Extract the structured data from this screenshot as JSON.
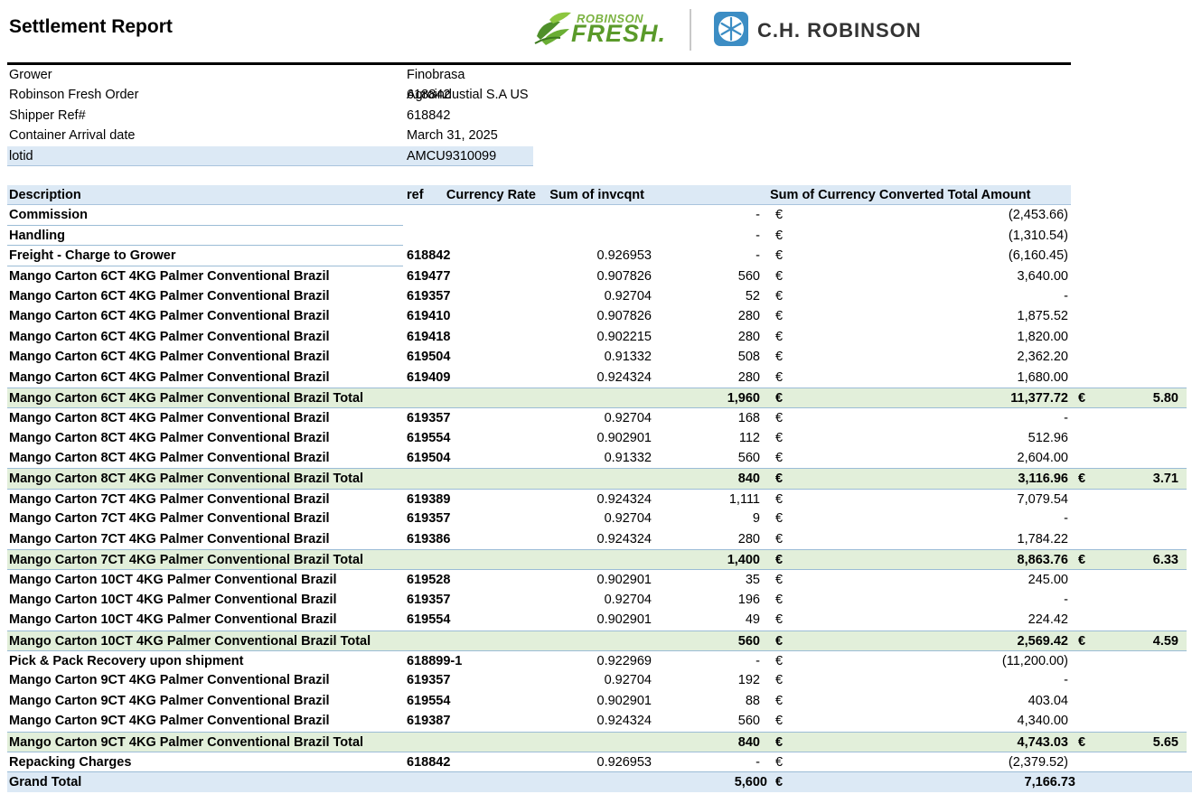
{
  "header": {
    "title": "Settlement Report",
    "logo_fresh_top": "ROBINSON",
    "logo_fresh_main": "FRESH.",
    "logo_chr": "C.H. ROBINSON"
  },
  "info": [
    {
      "label": "Grower",
      "value": "Finobrasa Agroindustial S.A US"
    },
    {
      "label": "Robinson Fresh Order",
      "value": "618842"
    },
    {
      "label": "Shipper Ref#",
      "value": "618842"
    },
    {
      "label": "Container Arrival date",
      "value": "March 31, 2025"
    },
    {
      "label": "lotid",
      "value": "AMCU9310099"
    }
  ],
  "table": {
    "columns": {
      "description": "Description",
      "ref": "ref",
      "rate": "Currency Rate",
      "qty": "Sum of invcqnt",
      "amount": "Sum of Currency Converted Total Amount"
    },
    "rows": [
      {
        "desc": "Commission",
        "ref": "",
        "rate": "",
        "qty": "-",
        "cur": "€",
        "amt": "(2,453.66)",
        "type": "plain"
      },
      {
        "desc": "Handling",
        "ref": "",
        "rate": "",
        "qty": "-",
        "cur": "€",
        "amt": "(1,310.54)",
        "type": "plain"
      },
      {
        "desc": "Freight - Charge to Grower",
        "ref": "618842",
        "rate": "0.926953",
        "qty": "-",
        "cur": "€",
        "amt": "(6,160.45)",
        "type": "plain"
      },
      {
        "desc": "Mango Carton 6CT 4KG Palmer Conventional Brazil",
        "ref": "619477",
        "rate": "0.907826",
        "qty": "560",
        "cur": "€",
        "amt": "3,640.00",
        "type": "plain"
      },
      {
        "desc": "Mango Carton 6CT 4KG Palmer Conventional Brazil",
        "ref": "619357",
        "rate": "0.92704",
        "qty": "52",
        "cur": "€",
        "amt": "-",
        "type": "plain"
      },
      {
        "desc": "Mango Carton 6CT 4KG Palmer Conventional Brazil",
        "ref": "619410",
        "rate": "0.907826",
        "qty": "280",
        "cur": "€",
        "amt": "1,875.52",
        "type": "plain"
      },
      {
        "desc": "Mango Carton 6CT 4KG Palmer Conventional Brazil",
        "ref": "619418",
        "rate": "0.902215",
        "qty": "280",
        "cur": "€",
        "amt": "1,820.00",
        "type": "plain"
      },
      {
        "desc": "Mango Carton 6CT 4KG Palmer Conventional Brazil",
        "ref": "619504",
        "rate": "0.91332",
        "qty": "508",
        "cur": "€",
        "amt": "2,362.20",
        "type": "plain"
      },
      {
        "desc": "Mango Carton 6CT 4KG Palmer Conventional Brazil",
        "ref": "619409",
        "rate": "0.924324",
        "qty": "280",
        "cur": "€",
        "amt": "1,680.00",
        "type": "plain"
      },
      {
        "desc": "Mango Carton 6CT 4KG Palmer Conventional Brazil Total",
        "ref": "",
        "rate": "",
        "qty": "1,960",
        "cur": "€",
        "amt": "11,377.72",
        "cur2": "€",
        "unit": "5.80",
        "type": "total"
      },
      {
        "desc": "Mango Carton 8CT 4KG Palmer Conventional Brazil",
        "ref": "619357",
        "rate": "0.92704",
        "qty": "168",
        "cur": "€",
        "amt": "-",
        "type": "plain"
      },
      {
        "desc": "Mango Carton 8CT 4KG Palmer Conventional Brazil",
        "ref": "619554",
        "rate": "0.902901",
        "qty": "112",
        "cur": "€",
        "amt": "512.96",
        "type": "plain"
      },
      {
        "desc": "Mango Carton 8CT 4KG Palmer Conventional Brazil",
        "ref": "619504",
        "rate": "0.91332",
        "qty": "560",
        "cur": "€",
        "amt": "2,604.00",
        "type": "plain"
      },
      {
        "desc": "Mango Carton 8CT 4KG Palmer Conventional Brazil Total",
        "ref": "",
        "rate": "",
        "qty": "840",
        "cur": "€",
        "amt": "3,116.96",
        "cur2": "€",
        "unit": "3.71",
        "type": "total"
      },
      {
        "desc": "Mango Carton 7CT 4KG Palmer Conventional Brazil",
        "ref": "619389",
        "rate": "0.924324",
        "qty": "1,111",
        "cur": "€",
        "amt": "7,079.54",
        "type": "plain"
      },
      {
        "desc": "Mango Carton 7CT 4KG Palmer Conventional Brazil",
        "ref": "619357",
        "rate": "0.92704",
        "qty": "9",
        "cur": "€",
        "amt": "-",
        "type": "plain"
      },
      {
        "desc": "Mango Carton 7CT 4KG Palmer Conventional Brazil",
        "ref": "619386",
        "rate": "0.924324",
        "qty": "280",
        "cur": "€",
        "amt": "1,784.22",
        "type": "plain"
      },
      {
        "desc": "Mango Carton 7CT 4KG Palmer Conventional Brazil Total",
        "ref": "",
        "rate": "",
        "qty": "1,400",
        "cur": "€",
        "amt": "8,863.76",
        "cur2": "€",
        "unit": "6.33",
        "type": "total"
      },
      {
        "desc": "Mango Carton 10CT 4KG Palmer Conventional Brazil",
        "ref": "619528",
        "rate": "0.902901",
        "qty": "35",
        "cur": "€",
        "amt": "245.00",
        "type": "plain"
      },
      {
        "desc": "Mango Carton 10CT 4KG Palmer Conventional Brazil",
        "ref": "619357",
        "rate": "0.92704",
        "qty": "196",
        "cur": "€",
        "amt": "-",
        "type": "plain"
      },
      {
        "desc": "Mango Carton 10CT 4KG Palmer Conventional Brazil",
        "ref": "619554",
        "rate": "0.902901",
        "qty": "49",
        "cur": "€",
        "amt": "224.42",
        "type": "plain"
      },
      {
        "desc": "Mango Carton 10CT 4KG Palmer Conventional Brazil Total",
        "ref": "",
        "rate": "",
        "qty": "560",
        "cur": "€",
        "amt": "2,569.42",
        "cur2": "€",
        "unit": "4.59",
        "type": "total"
      },
      {
        "desc": "Pick & Pack Recovery upon shipment",
        "ref": "618899-1",
        "rate": "0.922969",
        "qty": "-",
        "cur": "€",
        "amt": "(11,200.00)",
        "type": "plain"
      },
      {
        "desc": "Mango Carton 9CT 4KG Palmer Conventional Brazil",
        "ref": "619357",
        "rate": "0.92704",
        "qty": "192",
        "cur": "€",
        "amt": "-",
        "type": "plain"
      },
      {
        "desc": "Mango Carton 9CT 4KG Palmer Conventional Brazil",
        "ref": "619554",
        "rate": "0.902901",
        "qty": "88",
        "cur": "€",
        "amt": "403.04",
        "type": "plain"
      },
      {
        "desc": "Mango Carton 9CT 4KG Palmer Conventional Brazil",
        "ref": "619387",
        "rate": "0.924324",
        "qty": "560",
        "cur": "€",
        "amt": "4,340.00",
        "type": "plain"
      },
      {
        "desc": "Mango Carton 9CT 4KG Palmer Conventional Brazil Total",
        "ref": "",
        "rate": "",
        "qty": "840",
        "cur": "€",
        "amt": "4,743.03",
        "cur2": "€",
        "unit": "5.65",
        "type": "total"
      },
      {
        "desc": "Repacking Charges",
        "ref": "618842",
        "rate": "0.926953",
        "qty": "-",
        "cur": "€",
        "amt": "(2,379.52)",
        "type": "plain"
      },
      {
        "desc": "Grand Total",
        "ref": "",
        "rate": "",
        "qty": "5,600",
        "cur": "€",
        "amt": "7,166.73",
        "type": "grand"
      }
    ]
  },
  "colors": {
    "header_bg": "#dce9f5",
    "total_bg": "#e2efda",
    "grid_line": "#9bbcd6",
    "fresh_green": "#5a9a2a",
    "chr_blue": "#3c8dc4"
  }
}
